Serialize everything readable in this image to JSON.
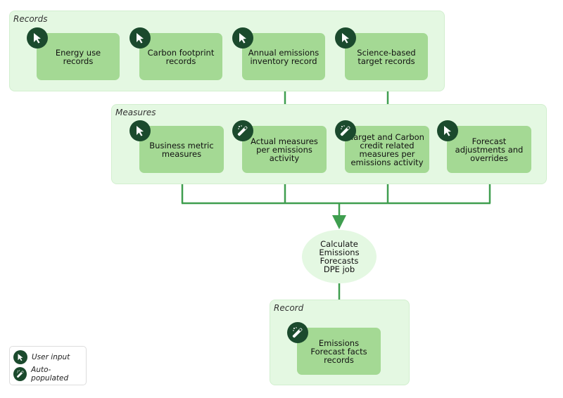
{
  "colors": {
    "group_bg": "#e4f8e2",
    "box": "#a4d994",
    "icon_bg": "#1b4a2d",
    "connector": "#3f9e4f"
  },
  "groups": {
    "records": "Records",
    "measures": "Measures",
    "record": "Record"
  },
  "records": [
    {
      "label": "Energy use records",
      "icon": "cursor-icon"
    },
    {
      "label": "Carbon footprint records",
      "icon": "cursor-icon"
    },
    {
      "label": "Annual emissions inventory record",
      "icon": "cursor-icon"
    },
    {
      "label": "Science-based target records",
      "icon": "cursor-icon"
    }
  ],
  "measures": [
    {
      "label": "Business metric measures",
      "icon": "cursor-icon"
    },
    {
      "label": "Actual measures per emissions activity",
      "icon": "magic-wand-icon"
    },
    {
      "label": "Target and Carbon credit related measures per emissions activity",
      "icon": "magic-wand-icon"
    },
    {
      "label": "Forecast adjustments and overrides",
      "icon": "cursor-icon"
    }
  ],
  "job": "Calculate Emissions Forecasts DPE job",
  "output": {
    "label": "Emissions Forecast facts records",
    "icon": "magic-wand-icon"
  },
  "legend": {
    "user_input": "User input",
    "auto_populated": "Auto-populated"
  }
}
